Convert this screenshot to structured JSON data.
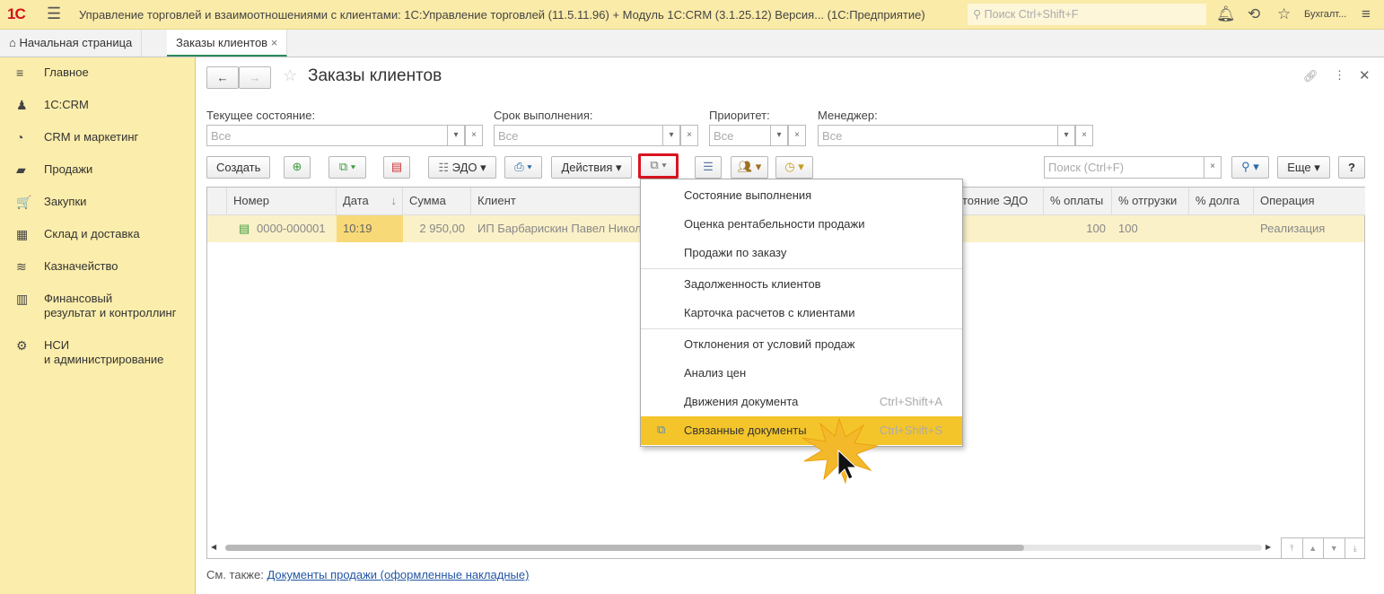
{
  "titlebar": {
    "logo": "1С",
    "title": "Управление торговлей и взаимоотношениями с клиентами: 1С:Управление торговлей (11.5.11.96) + Модуль 1С:CRM (3.1.25.12) Версия...   (1С:Предприятие)",
    "search_placeholder": "Поиск Ctrl+Shift+F",
    "user": "Бухгалт..."
  },
  "tabs": [
    {
      "label": "Начальная страница"
    },
    {
      "label": "Заказы клиентов",
      "close": "×"
    }
  ],
  "sidebar": {
    "items": [
      {
        "label": "Главное",
        "icon": "≡"
      },
      {
        "label": "1С:CRM",
        "icon": "♟"
      },
      {
        "label": "CRM и маркетинг",
        "icon": "◔"
      },
      {
        "label": "Продажи",
        "icon": "▰"
      },
      {
        "label": "Закупки",
        "icon": "🛒"
      },
      {
        "label": "Склад и доставка",
        "icon": "▦"
      },
      {
        "label": "Казначейство",
        "icon": "≋"
      },
      {
        "label": "Финансовый\nрезультат и контроллинг",
        "icon": "▥"
      },
      {
        "label": "НСИ\nи администрирование",
        "icon": "⚙"
      }
    ]
  },
  "form": {
    "title": "Заказы клиентов",
    "filters": [
      {
        "label": "Текущее состояние:",
        "value": "Все"
      },
      {
        "label": "Срок выполнения:",
        "value": "Все"
      },
      {
        "label": "Приоритет:",
        "value": "Все"
      },
      {
        "label": "Менеджер:",
        "value": "Все"
      }
    ],
    "toolbar": {
      "create": "Создать",
      "edo": "ЭДО",
      "actions": "Действия",
      "search_placeholder": "Поиск (Ctrl+F)",
      "more": "Еще",
      "help": "?"
    },
    "columns": [
      "Номер",
      "Дата",
      "Сумма",
      "Клиент",
      "тояние ЭДО",
      "% оплаты",
      "% отгрузки",
      "% долга",
      "Операция"
    ],
    "row": {
      "number": "0000-000001",
      "date": "10:19",
      "sum": "2 950,00",
      "client": "ИП Барбарискин Павел Никол",
      "paid": "100",
      "shipped": "100",
      "debt": "",
      "operation": "Реализация"
    },
    "footer_label": "См. также:",
    "footer_link": "Документы продажи (оформленные накладные)"
  },
  "menu": {
    "items": [
      {
        "label": "Состояние выполнения"
      },
      {
        "label": "Оценка рентабельности продажи"
      },
      {
        "label": "Продажи по заказу"
      },
      {
        "label": "Задолженность клиентов"
      },
      {
        "label": "Карточка расчетов с клиентами"
      },
      {
        "label": "Отклонения от условий продаж"
      },
      {
        "label": "Анализ цен"
      },
      {
        "label": "Движения документа",
        "shortcut": "Ctrl+Shift+A"
      },
      {
        "label": "Связанные документы",
        "shortcut": "Ctrl+Shift+S"
      }
    ]
  },
  "colors": {
    "accent": "#f4c52a",
    "sidebar": "#fbedab",
    "highlight_box": "#d9141e"
  }
}
